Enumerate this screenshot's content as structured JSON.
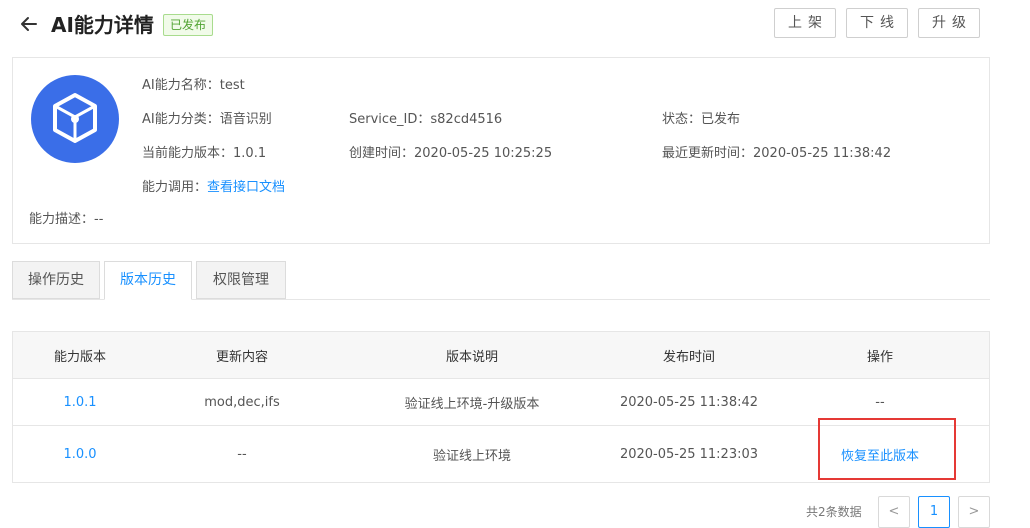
{
  "header": {
    "title": "AI能力详情",
    "badge": "已发布",
    "buttons": {
      "publish": "上架",
      "offline": "下线",
      "upgrade": "升级"
    }
  },
  "info": {
    "name_label": "AI能力名称：",
    "name_value": "test",
    "category_label": "AI能力分类：",
    "category_value": "语音识别",
    "service_label": "Service_ID：",
    "service_value": "s82cd4516",
    "status_label": "状态：",
    "status_value": "已发布",
    "version_label": "当前能力版本：",
    "version_value": "1.0.1",
    "created_label": "创建时间：",
    "created_value": "2020-05-25 10:25:25",
    "updated_label": "最近更新时间：",
    "updated_value": "2020-05-25 11:38:42",
    "invoke_label": "能力调用：",
    "invoke_link": "查看接口文档",
    "desc_label": "能力描述：",
    "desc_value": "--"
  },
  "tabs": [
    "操作历史",
    "版本历史",
    "权限管理"
  ],
  "table": {
    "headers": [
      "能力版本",
      "更新内容",
      "版本说明",
      "发布时间",
      "操作"
    ],
    "rows": [
      [
        "1.0.1",
        "mod,dec,ifs",
        "验证线上环境-升级版本",
        "2020-05-25 11:38:42",
        "--"
      ],
      [
        "1.0.0",
        "--",
        "验证线上环境",
        "2020-05-25 11:23:03",
        "恢复至此版本"
      ]
    ]
  },
  "pager": {
    "total": "共2条数据",
    "prev": "<",
    "page": "1",
    "next": ">"
  },
  "colors": {
    "accent": "#1890ff",
    "badge_green": "#52a434",
    "highlight_red": "#e53935"
  }
}
